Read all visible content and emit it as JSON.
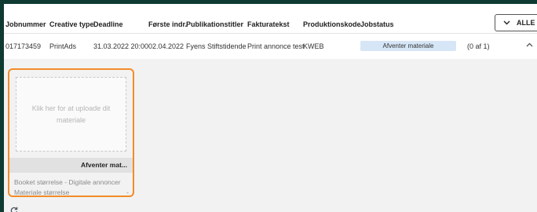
{
  "header": {
    "columns": [
      "Jobnummer",
      "Creative type",
      "Deadline",
      "Første indr.",
      "Publikationstitler",
      "Fakturatekst",
      "Produktionskode",
      "Jobstatus"
    ],
    "filter_label": "ALLE",
    "filter_icon": "chevron-down-icon"
  },
  "row": {
    "jobnummer": "017173459",
    "creative_type": "PrintAds",
    "deadline": "31.03.2022 20:00",
    "forste_indr": "02.04.2022",
    "publikationstitler": "Fyens Stiftstidende",
    "fakturatekst": "Print annonce test",
    "produktionskode": "KWEB",
    "jobstatus": "Afventer materiale",
    "count": "(0 af 1)",
    "expand_icon": "chevron-up-icon"
  },
  "card": {
    "upload_text": "Klik her for at uploade dit materiale",
    "status": "Afventer mat...",
    "booket_label": "Booket størrelse - Digitale annoncer",
    "materiale_label": "Materiale størrelse",
    "materiale_value": "-"
  },
  "refresh_icon": "refresh-icon",
  "colors": {
    "frame_bg": "#0f3a32",
    "card_border": "#f28c28",
    "status_pill": "#d6e6f7"
  }
}
